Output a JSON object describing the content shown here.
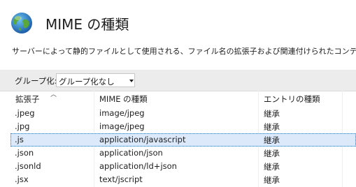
{
  "header": {
    "title": "MIME の種類"
  },
  "description": "サーバーによって静的ファイルとして使用される、ファイル名の拡張子および関連付けられたコンテンツの種類の",
  "toolbar": {
    "group_label": "グループ化:",
    "group_value": "グループ化なし"
  },
  "table": {
    "columns": [
      "拡張子",
      "MIME の種類",
      "エントリの種類"
    ],
    "rows": [
      [
        ".jpeg",
        "image/jpeg",
        "継承"
      ],
      [
        ".jpg",
        "image/jpeg",
        "継承"
      ],
      [
        ".js",
        "application/javascript",
        "継承"
      ],
      [
        ".json",
        "application/json",
        "継承"
      ],
      [
        ".jsonld",
        "application/ld+json",
        "継承"
      ],
      [
        ".jsx",
        "text/jscript",
        "継承"
      ]
    ],
    "selected_row": 2
  },
  "icons": {
    "header_icon": "globe-icon",
    "dropdown": "chevron-down-icon",
    "sort": "sort-up-icon"
  },
  "colors": {
    "toolbar_bg": "#ececec",
    "selected_row": "#dbe9fb",
    "selected_border": "#2d6fbc"
  }
}
